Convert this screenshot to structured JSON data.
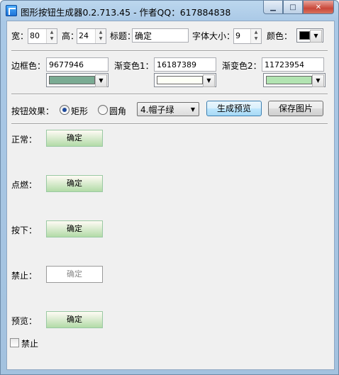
{
  "window": {
    "title": "图形按钮生成器0.2.713.45 - 作者QQ：617884838"
  },
  "caption": {
    "min": "▁",
    "max": "□",
    "close": "✕"
  },
  "row1": {
    "width_label": "宽：",
    "width_value": "80",
    "height_label": "高：",
    "height_value": "24",
    "caption_label": "标题：",
    "caption_value": "确定",
    "fontsize_label": "字体大小：",
    "fontsize_value": "9",
    "color_label": "颜色：",
    "color_value": "#000000"
  },
  "row2": {
    "border_label": "边框色：",
    "border_value": "9677946",
    "border_color": "#7aab93",
    "grad1_label": "渐变色1：",
    "grad1_value": "16187389",
    "grad1_color": "#fdfff6",
    "grad2_label": "渐变色2：",
    "grad2_value": "11723954",
    "grad2_color": "#b2e4b2"
  },
  "row3": {
    "effect_label": "按钮效果：",
    "rect_label": "矩形",
    "rect_checked": true,
    "round_label": "圆角",
    "round_checked": false,
    "style_select": "4.帽子绿",
    "generate_btn": "生成预览",
    "save_btn": "保存图片"
  },
  "previews": {
    "normal_label": "正常：",
    "normal_btn": "确定",
    "hover_label": "点燃：",
    "hover_btn": "确定",
    "pressed_label": "按下：",
    "pressed_btn": "确定",
    "disabled_label": "禁止：",
    "disabled_btn": "确定",
    "preview_label": "预览：",
    "preview_btn": "确定"
  },
  "disable_checkbox": {
    "label": "禁止",
    "checked": false
  },
  "colors": {
    "window_frame": "#a9c8e6",
    "client_bg": "#f0f0f0"
  }
}
